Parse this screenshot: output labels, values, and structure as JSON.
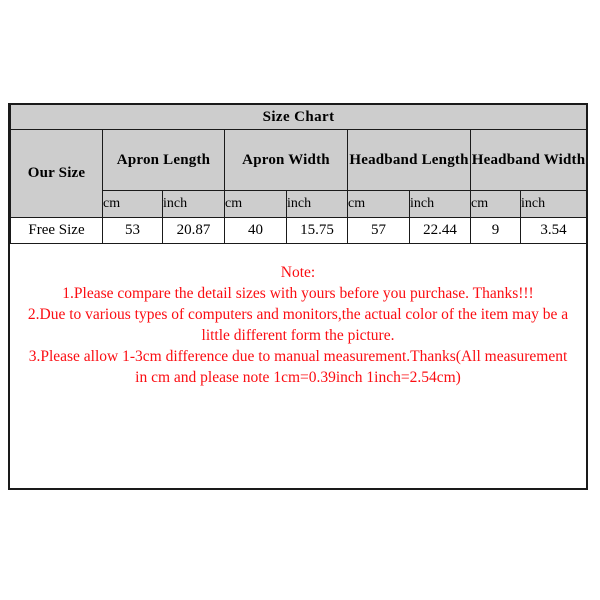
{
  "chart": {
    "title": "Size Chart",
    "first_column_header": "Our Size",
    "groups": [
      {
        "label": "Apron Length"
      },
      {
        "label": "Apron Width"
      },
      {
        "label": "Headband Length"
      },
      {
        "label": "Headband Width"
      }
    ],
    "units": [
      "cm",
      "inch",
      "cm",
      "inch",
      "cm",
      "inch",
      "cm",
      "inch"
    ],
    "rows": [
      {
        "size": "Free Size",
        "values": [
          "53",
          "20.87",
          "40",
          "15.75",
          "57",
          "22.44",
          "9",
          "3.54"
        ]
      }
    ],
    "colors": {
      "header_background": "#cdcdcd",
      "cell_background": "#ffffff",
      "border": "#1a1a1a",
      "note_text": "#fb0d12"
    }
  },
  "note": {
    "heading": "Note:",
    "lines": [
      "1.Please compare the detail sizes with yours before you purchase. Thanks!!!",
      "2.Due to various types of computers and monitors,the actual color of the item may be a little different form the picture.",
      "3.Please allow 1-3cm difference due to manual measurement.Thanks(All measurement in cm and please note 1cm=0.39inch 1inch=2.54cm)"
    ]
  },
  "chart_data": {
    "type": "table",
    "title": "Size Chart",
    "columns": [
      "Our Size",
      "Apron Length cm",
      "Apron Length inch",
      "Apron Width cm",
      "Apron Width inch",
      "Headband Length cm",
      "Headband Length inch",
      "Headband Width cm",
      "Headband Width inch"
    ],
    "rows": [
      [
        "Free Size",
        "53",
        "20.87",
        "40",
        "15.75",
        "57",
        "22.44",
        "9",
        "3.54"
      ]
    ]
  }
}
